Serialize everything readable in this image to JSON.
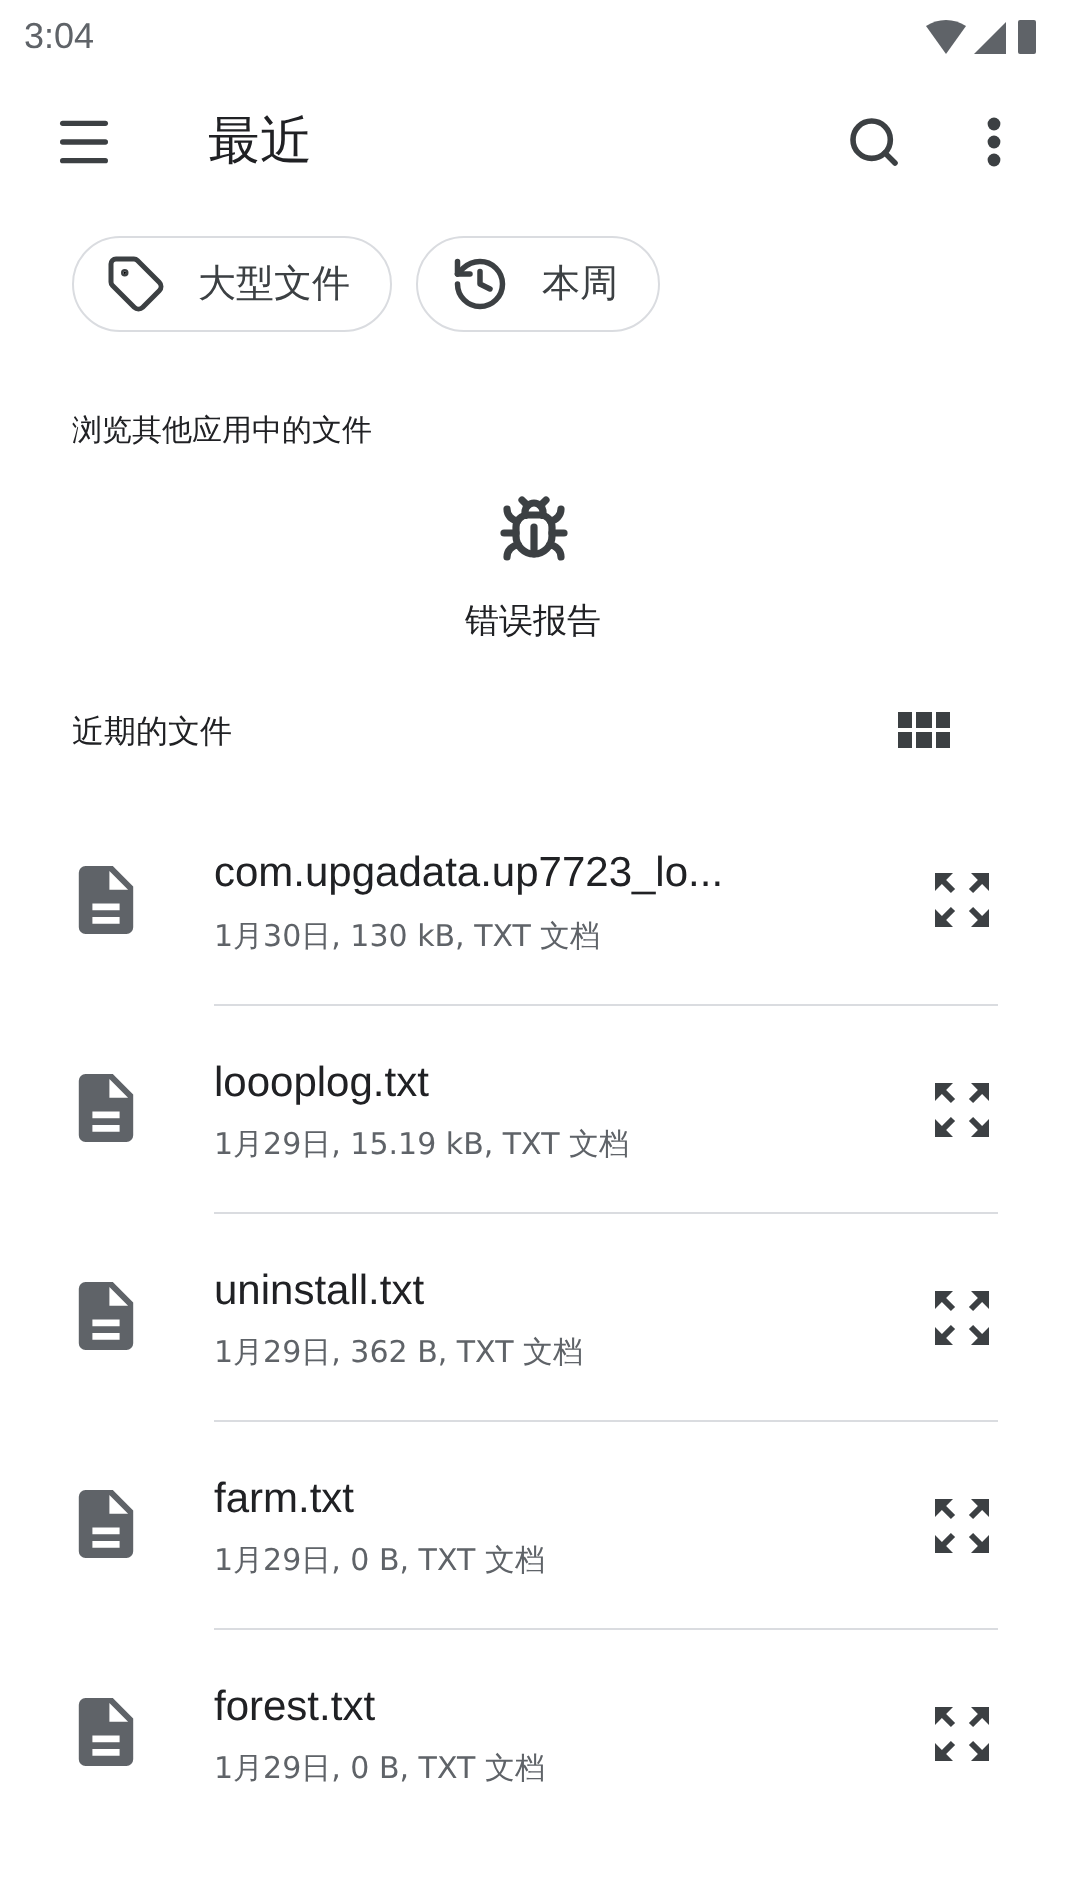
{
  "status_bar": {
    "time": "3:04"
  },
  "toolbar": {
    "title": "最近"
  },
  "chips": [
    {
      "kind": "tag",
      "label": "大型文件"
    },
    {
      "kind": "history",
      "label": "本周"
    }
  ],
  "other_apps": {
    "heading": "浏览其他应用中的文件",
    "apps": [
      {
        "label": "错误报告"
      }
    ]
  },
  "recent": {
    "heading": "近期的文件"
  },
  "files": [
    {
      "name": "com.upgadata.up7723_lo...",
      "details": "1月30日, 130 kB, TXT 文档"
    },
    {
      "name": "loooplog.txt",
      "details": "1月29日, 15.19 kB, TXT 文档"
    },
    {
      "name": "uninstall.txt",
      "details": "1月29日, 362 B, TXT 文档"
    },
    {
      "name": "farm.txt",
      "details": "1月29日, 0 B, TXT 文档"
    },
    {
      "name": "forest.txt",
      "details": "1月29日, 0 B, TXT 文档"
    }
  ]
}
